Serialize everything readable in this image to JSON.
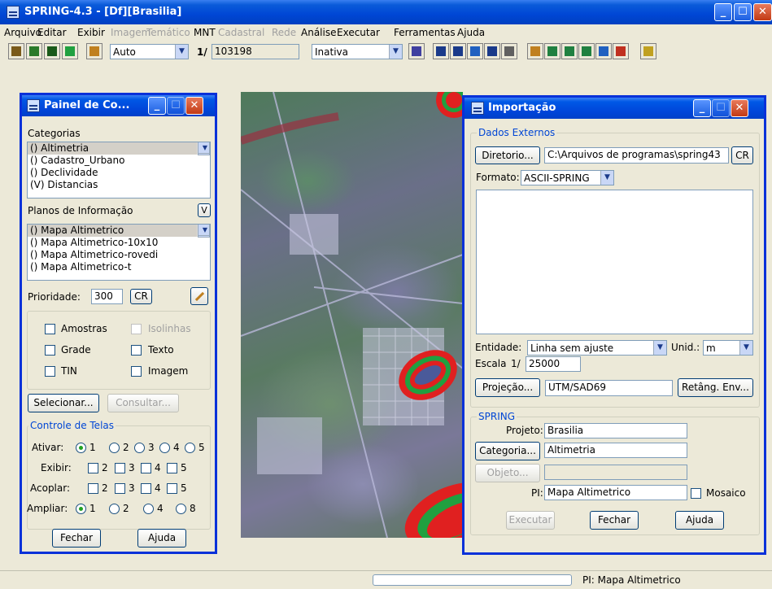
{
  "app": {
    "title": "SPRING-4.3 - [Df][Brasilia]"
  },
  "menu": [
    {
      "label": "Arquivo",
      "enabled": true
    },
    {
      "label": "Editar",
      "enabled": true
    },
    {
      "label": "Exibir",
      "enabled": true
    },
    {
      "label": "Imagem",
      "enabled": false
    },
    {
      "label": "Temático",
      "enabled": false
    },
    {
      "label": "MNT",
      "enabled": true
    },
    {
      "label": "Cadastral",
      "enabled": false
    },
    {
      "label": "Rede",
      "enabled": false
    },
    {
      "label": "Análise",
      "enabled": true
    },
    {
      "label": "Executar",
      "enabled": true
    },
    {
      "label": "Ferramentas",
      "enabled": true
    },
    {
      "label": "Ajuda",
      "enabled": true
    }
  ],
  "toolbar": {
    "zoom_mode": "Auto",
    "scale_prefix": "1/",
    "scale_value": "103198",
    "state": "Inativa"
  },
  "panel": {
    "title": "Painel de Co...",
    "categories_label": "Categorias",
    "categories": [
      "() Altimetria",
      "() Cadastro_Urbano",
      "() Declividade",
      "(V) Distancias"
    ],
    "planes_label": "Planos de Informação",
    "planes_toggle": "V",
    "planes": [
      "() Mapa Altimetrico",
      "() Mapa Altimetrico-10x10",
      "() Mapa Altimetrico-rovedi",
      "() Mapa Altimetrico-t"
    ],
    "priority_label": "Prioridade:",
    "priority_value": "300",
    "cr_label": "CR",
    "checks": {
      "amostras": "Amostras",
      "isolinhas": "Isolinhas",
      "grade": "Grade",
      "texto": "Texto",
      "tin": "TIN",
      "imagem": "Imagem"
    },
    "selecionar": "Selecionar...",
    "consultar": "Consultar...",
    "screens_label": "Controle de Telas",
    "ativar_label": "Ativar:",
    "exibir_label": "Exibir:",
    "acoplar_label": "Acoplar:",
    "ampliar_label": "Ampliar:",
    "ativar_opts": [
      "1",
      "2",
      "3",
      "4",
      "5"
    ],
    "exibir_opts": [
      "2",
      "3",
      "4",
      "5"
    ],
    "acoplar_opts": [
      "2",
      "3",
      "4",
      "5"
    ],
    "ampliar_opts": [
      "1",
      "2",
      "4",
      "8"
    ],
    "fechar": "Fechar",
    "ajuda": "Ajuda"
  },
  "dialog": {
    "title": "Importação",
    "external_label": "Dados Externos",
    "diretorio_btn": "Diretorio...",
    "path": "C:\\Arquivos de programas\\spring43",
    "cr": "CR",
    "formato_label": "Formato:",
    "formato": "ASCII-SPRING",
    "entidade_label": "Entidade:",
    "entidade": "Linha sem ajuste",
    "unid_label": "Unid.:",
    "unid": "m",
    "escala_label": "Escala",
    "escala_prefix": "1/",
    "escala": "25000",
    "projecao_btn": "Projeção...",
    "projecao": "UTM/SAD69",
    "retang_btn": "Retâng. Env...",
    "spring_label": "SPRING",
    "projeto_label": "Projeto:",
    "projeto": "Brasilia",
    "categoria_btn": "Categoria...",
    "categoria": "Altimetria",
    "objeto_btn": "Objeto...",
    "objeto": "",
    "pi_label": "PI:",
    "pi": "Mapa Altimetrico",
    "mosaico": "Mosaico",
    "executar": "Executar",
    "fechar": "Fechar",
    "ajuda": "Ajuda"
  },
  "status": {
    "text": "PI: Mapa Altimetrico"
  }
}
